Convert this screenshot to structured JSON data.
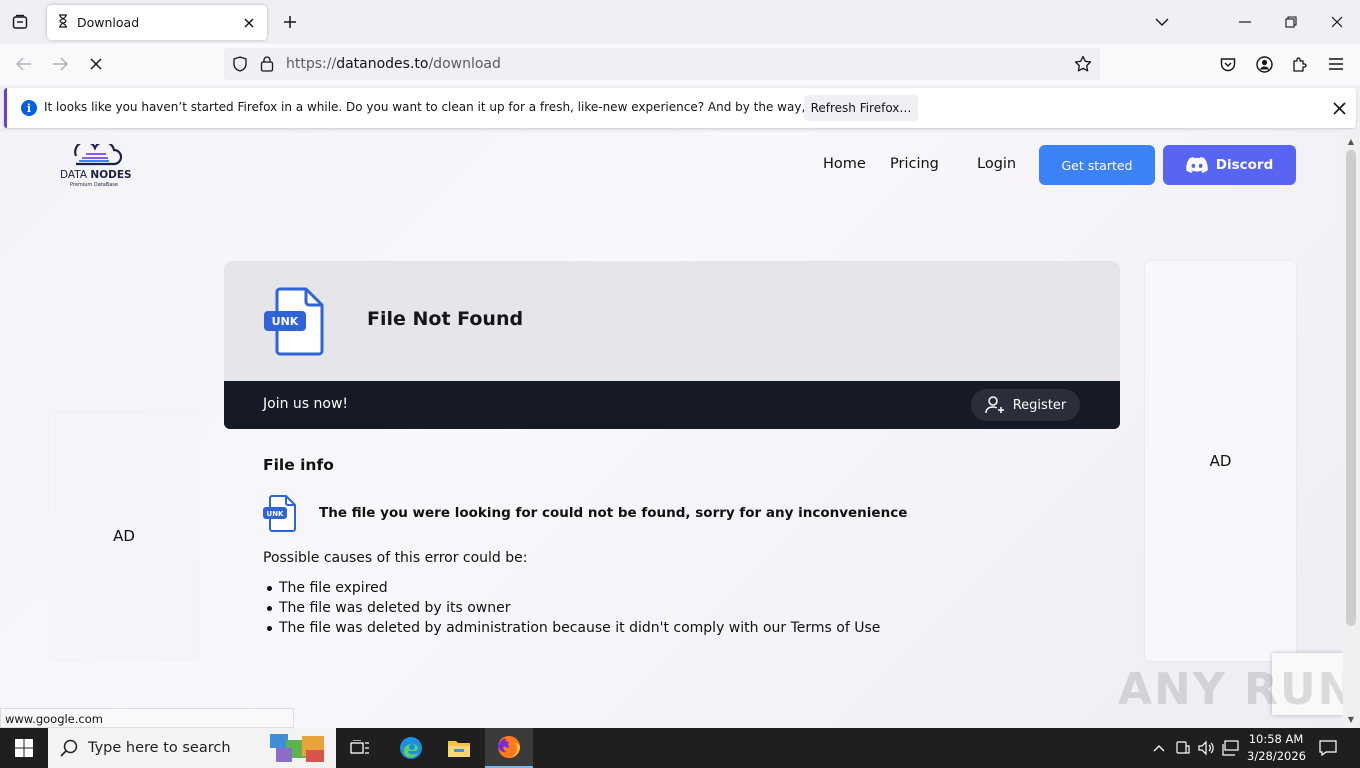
{
  "browser": {
    "tab_title": "Download",
    "url_prefix": "https://",
    "url_host": "datanodes.to",
    "url_path": "/download",
    "notification": {
      "message": "It looks like you haven’t started Firefox in a while. Do you want to clean it up for a fresh, like-new experience? And by the way, welcome back!",
      "button": "Refresh Firefox…",
      "icon": "info-icon"
    },
    "status_url": "www.google.com"
  },
  "site": {
    "logo_main": "DATA",
    "logo_bold": "NODES",
    "logo_sub": "Premium DataBase",
    "nav": {
      "home": "Home",
      "pricing": "Pricing",
      "login": "Login",
      "get_started": "Get started",
      "discord": "Discord"
    },
    "ad_left": "AD",
    "ad_right": "AD",
    "file_badge": "UNK",
    "card_title": "File Not Found",
    "join_text": "Join us now!",
    "register": "Register",
    "info_title": "File info",
    "info_message": "The file you were looking for could not be found, sorry for any inconvenience",
    "causes_title": "Possible causes of this error could be:",
    "causes": [
      "The file expired",
      "The file was deleted by its owner",
      "The file was deleted by administration because it didn't comply with our Terms of Use"
    ],
    "watermark": "ANY RUN"
  },
  "taskbar": {
    "search_placeholder": "Type here to search",
    "time": "10:58 AM",
    "date": "3/28/2026"
  },
  "colors": {
    "accent_blue": "#3b82f6",
    "discord": "#5865f2",
    "join_bar": "#161a26",
    "file_icon": "#2f63d8"
  }
}
